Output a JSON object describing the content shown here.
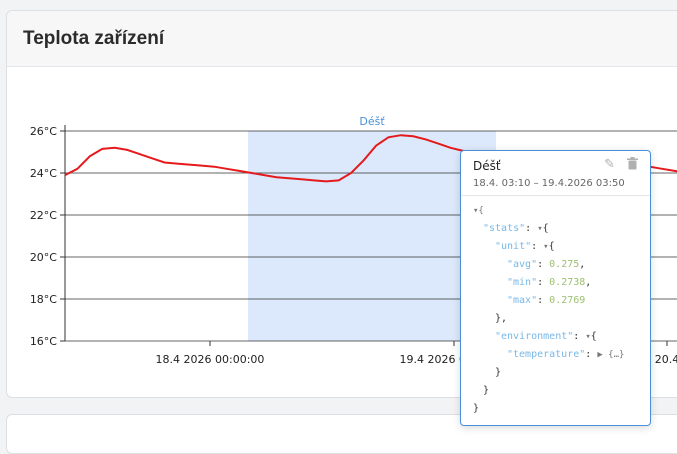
{
  "card": {
    "title": "Teplota zařízení"
  },
  "chart_data": {
    "type": "line",
    "ylim": [
      16,
      26
    ],
    "yticks": [
      "16°C",
      "18°C",
      "20°C",
      "22°C",
      "24°C",
      "26°C"
    ],
    "ytick_values": [
      16,
      18,
      20,
      22,
      24,
      26
    ],
    "xticks": [
      "18.4 2026 00:00:00",
      "19.4 2026 00:00:00",
      "20.4"
    ],
    "series": [
      {
        "color": "#e41a1c",
        "values": [
          23.9,
          24.2,
          24.8,
          25.15,
          25.2,
          25.1,
          24.9,
          24.7,
          24.5,
          24.45,
          24.4,
          24.35,
          24.3,
          24.2,
          24.1,
          24.0,
          23.9,
          23.8,
          23.75,
          23.7,
          23.65,
          23.6,
          23.65,
          24.0,
          24.6,
          25.3,
          25.7,
          25.8,
          25.75,
          25.6,
          25.4,
          25.2,
          25.05,
          24.9,
          24.75,
          24.6,
          24.5,
          24.45,
          24.5,
          24.55,
          24.6,
          24.65,
          24.7,
          24.75,
          24.7,
          24.6,
          24.45,
          24.3,
          24.2,
          24.1,
          24.0
        ]
      }
    ],
    "annotation": {
      "label": "Déšť"
    }
  },
  "popup": {
    "title": "Déšť",
    "range": "18.4. 03:10 – 19.4.2026 03:50",
    "edit_icon": "pencil-icon",
    "delete_icon": "trash-icon",
    "tree": {
      "open_brace": "▾{",
      "stats_key": "\"stats\"",
      "unit_key": "\"unit\"",
      "avg_key": "\"avg\"",
      "avg": "0.275",
      "min_key": "\"min\"",
      "min": "0.2738",
      "max_key": "\"max\"",
      "max": "0.2769",
      "environment_key": "\"environment\"",
      "temperature_key": "\"temperature\"",
      "collapsed": "▶ {…}"
    }
  }
}
